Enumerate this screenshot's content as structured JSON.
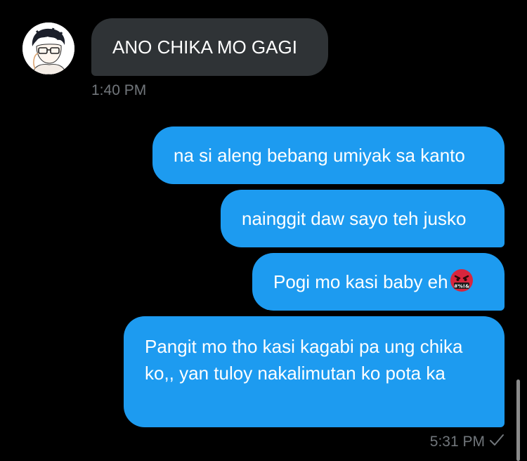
{
  "conversation": {
    "incoming": {
      "avatar_icon": "user-avatar-icon",
      "message": "ANO CHIKA MO GAGI",
      "time": "1:40 PM"
    },
    "outgoing": {
      "messages": [
        {
          "text": "na si aleng bebang umiyak sa kanto"
        },
        {
          "text": "nainggit daw sayo teh jusko"
        },
        {
          "text": "Pogi mo kasi baby eh",
          "emoji": "face-with-symbols-on-mouth-icon"
        },
        {
          "text": "Pangit mo tho kasi kagabi pa ung chika ko,, yan tuloy nakalimutan ko pota ka"
        }
      ],
      "time": "5:31 PM",
      "status_icon": "check-icon"
    }
  },
  "colors": {
    "background": "#000000",
    "incoming_bubble": "#2f3336",
    "outgoing_bubble": "#1d9bf0",
    "timestamp": "#71767b"
  }
}
